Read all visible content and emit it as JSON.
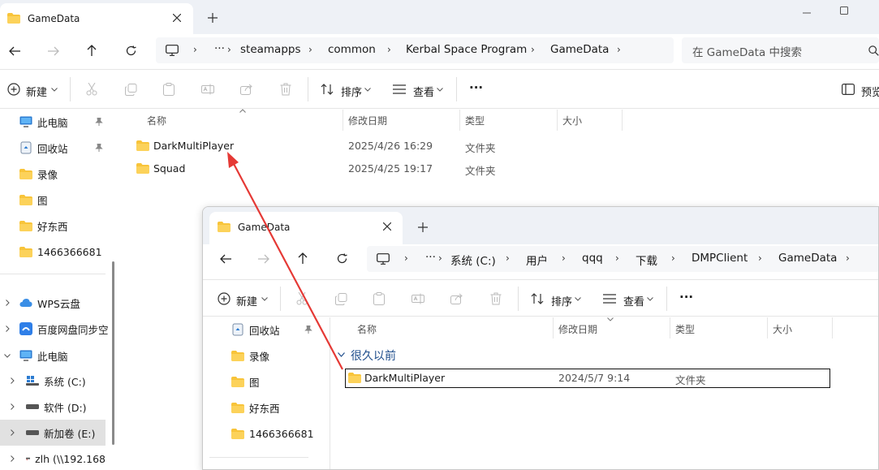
{
  "win1": {
    "tab_title": "GameData",
    "tab_close_icon": "close-icon",
    "new_tab_icon": "plus-icon",
    "breadcrumb": [
      "steamapps",
      "common",
      "Kerbal Space Program",
      "GameData"
    ],
    "more_crumbs": "···",
    "search_placeholder": "在 GameData 中搜索",
    "cmd": {
      "new_label": "新建",
      "sort_label": "排序",
      "view_label": "查看",
      "more_label": "···",
      "preview_label": "预览"
    },
    "sidebar": [
      {
        "label": "此电脑",
        "icon": "monitor-icon",
        "pinned": true
      },
      {
        "label": "回收站",
        "icon": "recycle-bin-icon",
        "pinned": true
      },
      {
        "label": "录像",
        "icon": "folder-icon"
      },
      {
        "label": "图",
        "icon": "folder-icon"
      },
      {
        "label": "好东西",
        "icon": "folder-icon"
      },
      {
        "label": "1466366681",
        "icon": "folder-icon"
      },
      {
        "label": "WPS云盘",
        "icon": "cloud-icon"
      },
      {
        "label": "百度网盘同步空",
        "icon": "baidu-icon"
      },
      {
        "label": "此电脑",
        "icon": "monitor-icon"
      },
      {
        "label": "系统 (C:)",
        "icon": "windows-drive-icon"
      },
      {
        "label": "软件 (D:)",
        "icon": "drive-icon"
      },
      {
        "label": "新加卷 (E:)",
        "icon": "drive-icon"
      },
      {
        "label": "zlh (\\\\192.168",
        "icon": "network-drive-icon"
      }
    ],
    "columns": [
      "名称",
      "修改日期",
      "类型",
      "大小"
    ],
    "rows": [
      {
        "name": "DarkMultiPlayer",
        "date": "2025/4/26 16:29",
        "type": "文件夹"
      },
      {
        "name": "Squad",
        "date": "2025/4/25 19:17",
        "type": "文件夹"
      }
    ]
  },
  "win2": {
    "tab_title": "GameData",
    "breadcrumb": [
      "系统 (C:)",
      "用户",
      "qqq",
      "下载",
      "DMPClient",
      "GameData"
    ],
    "more_crumbs": "···",
    "cmd": {
      "new_label": "新建",
      "sort_label": "排序",
      "view_label": "查看",
      "more_label": "···"
    },
    "sidebar": [
      {
        "label": "回收站",
        "icon": "recycle-bin-icon",
        "pinned": true
      },
      {
        "label": "录像",
        "icon": "folder-icon"
      },
      {
        "label": "图",
        "icon": "folder-icon"
      },
      {
        "label": "好东西",
        "icon": "folder-icon"
      },
      {
        "label": "1466366681",
        "icon": "folder-icon"
      }
    ],
    "columns": [
      "名称",
      "修改日期",
      "类型",
      "大小"
    ],
    "group_label": "很久以前",
    "rows": [
      {
        "name": "DarkMultiPlayer",
        "date": "2024/5/7 9:14",
        "type": "文件夹"
      }
    ]
  },
  "colors": {
    "accent": "#005fb8",
    "folder": "#f8c43a",
    "folder_dark": "#e8a810",
    "arrow": "#e53935",
    "tabbar_bg": "#eef1f6"
  }
}
